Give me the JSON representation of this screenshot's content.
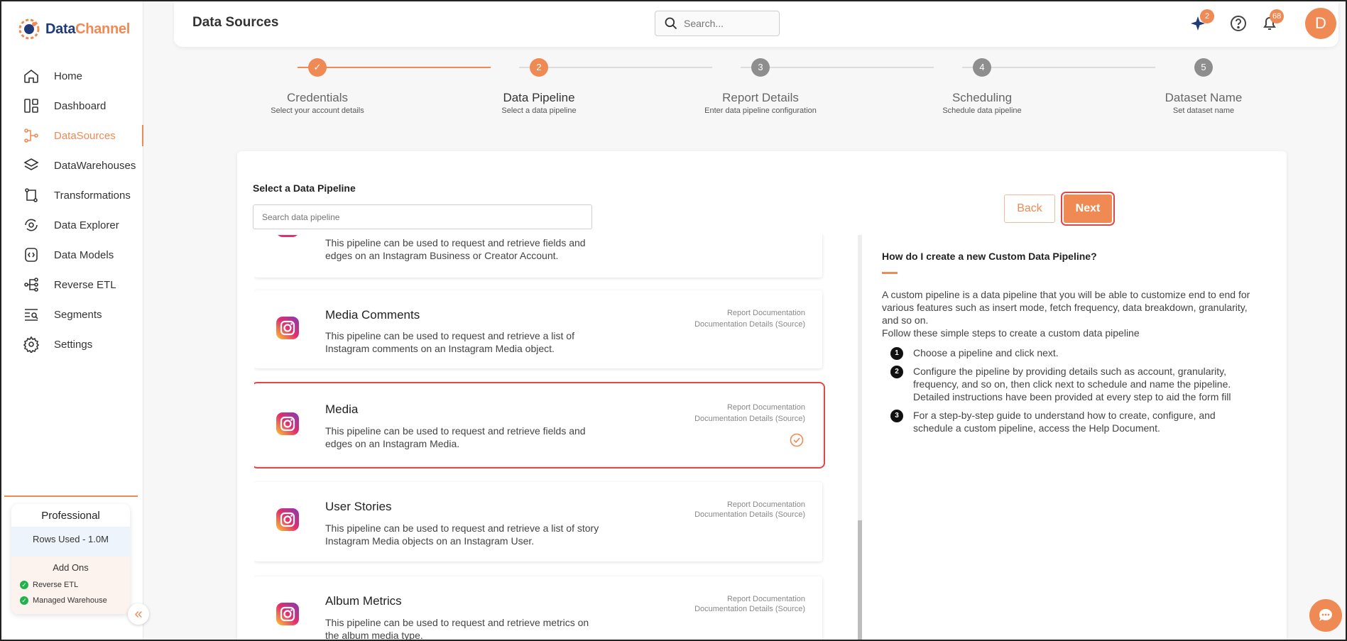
{
  "app": {
    "brand_part1": "Data",
    "brand_part2": "Channel"
  },
  "sidebar": {
    "items": [
      {
        "label": "Home",
        "icon": "home-icon"
      },
      {
        "label": "Dashboard",
        "icon": "dashboard-icon"
      },
      {
        "label": "DataSources",
        "icon": "datasources-icon",
        "active": true
      },
      {
        "label": "DataWarehouses",
        "icon": "layers-icon"
      },
      {
        "label": "Transformations",
        "icon": "transform-icon"
      },
      {
        "label": "Data Explorer",
        "icon": "explorer-icon"
      },
      {
        "label": "Data Models",
        "icon": "models-icon"
      },
      {
        "label": "Reverse ETL",
        "icon": "reverse-etl-icon"
      },
      {
        "label": "Segments",
        "icon": "segments-icon"
      },
      {
        "label": "Settings",
        "icon": "gear-icon"
      }
    ],
    "plan": {
      "name": "Professional",
      "rows_used": "Rows Used - 1.0M",
      "addons_title": "Add Ons",
      "addons": [
        "Reverse ETL",
        "Managed Warehouse"
      ]
    }
  },
  "header": {
    "title": "Data Sources",
    "search_placeholder": "Search...",
    "sparkle_badge": "2",
    "notifications_badge": "68",
    "avatar_letter": "D"
  },
  "stepper": {
    "steps": [
      {
        "number": "1",
        "label": "Credentials",
        "sub": "Select your account details",
        "status": "done"
      },
      {
        "number": "2",
        "label": "Data Pipeline",
        "sub": "Select a data pipeline",
        "status": "active"
      },
      {
        "number": "3",
        "label": "Report Details",
        "sub": "Enter data pipeline configuration",
        "status": "pending"
      },
      {
        "number": "4",
        "label": "Scheduling",
        "sub": "Schedule data pipeline",
        "status": "pending"
      },
      {
        "number": "5",
        "label": "Dataset Name",
        "sub": "Set dataset name",
        "status": "pending"
      }
    ]
  },
  "main": {
    "select_label": "Select a Data Pipeline",
    "search_placeholder": "Search data pipeline",
    "back_label": "Back",
    "next_label": "Next",
    "pipelines": [
      {
        "name": "",
        "desc": "This pipeline can be used to request and retrieve fields and edges on an Instagram Business or Creator Account.",
        "link1": "",
        "link2": ""
      },
      {
        "name": "Media Comments",
        "desc": "This pipeline can be used to request and retrieve a list of Instagram comments on an Instagram Media object.",
        "link1": "Report Documentation",
        "link2": "Documentation Details (Source)"
      },
      {
        "name": "Media",
        "desc": "This pipeline can be used to request and retrieve fields and edges on an Instagram Media.",
        "link1": "Report Documentation",
        "link2": "Documentation Details (Source)",
        "selected": true
      },
      {
        "name": "User Stories",
        "desc": "This pipeline can be used to request and retrieve a list of story Instagram Media objects on an Instagram User.",
        "link1": "Report Documentation",
        "link2": "Documentation Details (Source)"
      },
      {
        "name": "Album Metrics",
        "desc": "This pipeline can be used to request and retrieve metrics on the album media type.",
        "link1": "Report Documentation",
        "link2": "Documentation Details (Source)"
      }
    ],
    "help": {
      "title": "How do I create a new Custom Data Pipeline?",
      "intro": "A custom pipeline is a data pipeline that you will be able to customize end to end for various features such as insert mode, fetch frequency, data breakdown, granularity, and so on.",
      "intro2": "Follow these simple steps to create a custom data pipeline",
      "steps": [
        "Choose a pipeline and click next.",
        "Configure the pipeline by providing details such as account, granularity, frequency, and so on, then click next to schedule and name the pipeline. Detailed instructions have been provided at every step to aid the form fill",
        "For a step-by-step guide to understand how to create, configure, and schedule a custom pipeline, access the Help Document."
      ]
    }
  },
  "colors": {
    "accent": "#f08a54",
    "highlight": "#e04848"
  }
}
